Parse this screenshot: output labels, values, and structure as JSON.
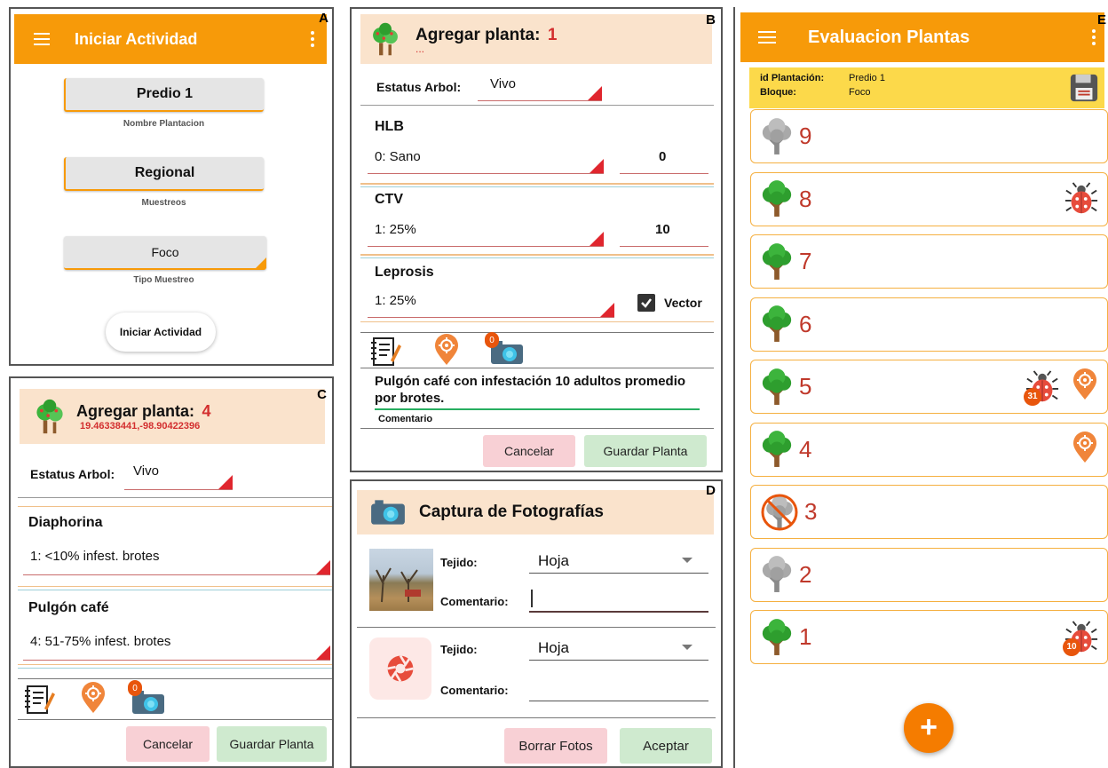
{
  "labels": {
    "a": "A",
    "b": "B",
    "c": "C",
    "d": "D",
    "e": "E"
  },
  "panelA": {
    "title": "Iniciar Actividad",
    "predio": "Predio 1",
    "predio_caption": "Nombre Plantacion",
    "muestreo": "Regional",
    "muestreo_caption": "Muestreos",
    "tipo": "Foco",
    "tipo_caption": "Tipo Muestreo",
    "start_button": "Iniciar Actividad"
  },
  "panelB": {
    "title": "Agregar planta:",
    "number": "1",
    "coords": "...",
    "estatus_label": "Estatus Arbol:",
    "estatus_value": "Vivo",
    "hlb_title": "HLB",
    "hlb_value": "0: Sano",
    "hlb_num": "0",
    "ctv_title": "CTV",
    "ctv_value": "1: 25%",
    "ctv_num": "10",
    "leprosis_title": "Leprosis",
    "leprosis_value": "1: 25%",
    "vector_label": "Vector",
    "camera_badge": "0",
    "comment_text": "Pulgón café con infestación 10 adultos promedio por brotes.",
    "comment_label": "Comentario",
    "cancel": "Cancelar",
    "save": "Guardar Planta"
  },
  "panelC": {
    "title": "Agregar planta:",
    "number": "4",
    "coords": "19.46338441,-98.90422396",
    "estatus_label": "Estatus Arbol:",
    "estatus_value": "Vivo",
    "diaphorina_title": "Diaphorina",
    "diaphorina_value": "1: <10% infest. brotes",
    "pulgon_title": "Pulgón café",
    "pulgon_value": "4: 51-75% infest. brotes",
    "camera_badge": "0",
    "cancel": "Cancelar",
    "save": "Guardar Planta"
  },
  "panelD": {
    "title": "Captura de Fotografías",
    "rows": [
      {
        "tejido_label": "Tejido:",
        "tejido_value": "Hoja",
        "comentario_label": "Comentario:",
        "comentario_value": ""
      },
      {
        "tejido_label": "Tejido:",
        "tejido_value": "Hoja",
        "comentario_label": "Comentario:",
        "comentario_value": ""
      }
    ],
    "delete_button": "Borrar Fotos",
    "accept_button": "Aceptar"
  },
  "panelE": {
    "title": "Evaluacion Plantas",
    "id_label": "id Plantación:",
    "id_value": "Predio 1",
    "bloque_label": "Bloque:",
    "bloque_value": "Foco",
    "plants": [
      {
        "number": "9",
        "tree": "grey",
        "bug": false,
        "bug_badge": "",
        "pin": false
      },
      {
        "number": "8",
        "tree": "green",
        "bug": true,
        "bug_badge": "",
        "pin": false
      },
      {
        "number": "7",
        "tree": "green",
        "bug": false,
        "bug_badge": "",
        "pin": false
      },
      {
        "number": "6",
        "tree": "green",
        "bug": false,
        "bug_badge": "",
        "pin": false
      },
      {
        "number": "5",
        "tree": "green",
        "bug": true,
        "bug_badge": "31",
        "pin": true
      },
      {
        "number": "4",
        "tree": "green",
        "bug": false,
        "bug_badge": "",
        "pin": true
      },
      {
        "number": "3",
        "tree": "dead",
        "bug": false,
        "bug_badge": "",
        "pin": false
      },
      {
        "number": "2",
        "tree": "grey",
        "bug": false,
        "bug_badge": "",
        "pin": false
      },
      {
        "number": "1",
        "tree": "green",
        "bug": true,
        "bug_badge": "10",
        "pin": false
      }
    ],
    "fab": "+"
  },
  "colors": {
    "orange": "#f79a09",
    "red": "#e0262e",
    "peach": "#fae3cc",
    "yellow": "#fcd94a",
    "card_border": "#f5b041",
    "number_red": "#c0392b"
  }
}
